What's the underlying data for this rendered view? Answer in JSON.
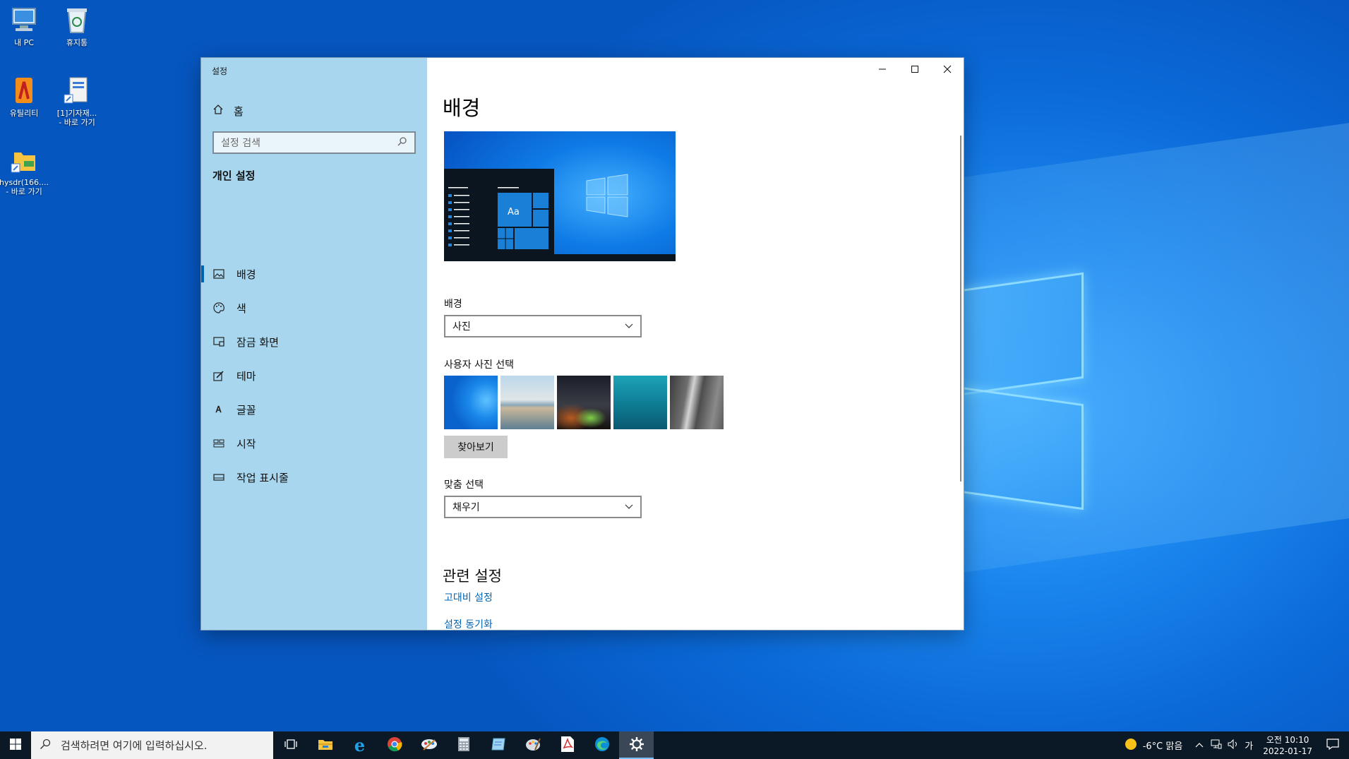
{
  "desktop": {
    "icons": [
      {
        "label": "내 PC",
        "icon": "computer-icon"
      },
      {
        "label": "휴지통",
        "icon": "recycle-bin-icon"
      },
      {
        "label": "유틸리티",
        "icon": "utility-app-icon"
      },
      {
        "label": "[1]기자재...",
        "label2": "- 바로 가기",
        "icon": "shortcut-file-icon"
      },
      {
        "label": "hysdr(166....",
        "label2": "- 바로 가기",
        "icon": "shortcut-folder-icon"
      }
    ]
  },
  "window": {
    "title": "설정",
    "controls": {
      "minimize": "minimize-icon",
      "maximize": "maximize-icon",
      "close": "close-icon"
    }
  },
  "sidebar": {
    "home": "홈",
    "search_placeholder": "설정 검색",
    "group": "개인 설정",
    "items": [
      {
        "label": "배경",
        "icon": "picture-icon",
        "active": true
      },
      {
        "label": "색",
        "icon": "palette-icon",
        "active": false
      },
      {
        "label": "잠금 화면",
        "icon": "lock-screen-icon",
        "active": false
      },
      {
        "label": "테마",
        "icon": "theme-brush-icon",
        "active": false
      },
      {
        "label": "글꼴",
        "icon": "font-icon",
        "active": false
      },
      {
        "label": "시작",
        "icon": "start-tiles-icon",
        "active": false
      },
      {
        "label": "작업 표시줄",
        "icon": "taskbar-icon",
        "active": false
      }
    ]
  },
  "content": {
    "title": "배경",
    "preview_tile": "Aa",
    "background_label": "배경",
    "background_value": "사진",
    "choose_picture_label": "사용자 사진 선택",
    "browse_button": "찾아보기",
    "fit_label": "맞춤 선택",
    "fit_value": "채우기",
    "related_title": "관련 설정",
    "links": [
      "고대비 설정",
      "설정 동기화"
    ]
  },
  "taskbar": {
    "search_placeholder": "검색하려면 여기에 입력하십시오.",
    "apps": [
      "task-view-icon",
      "file-explorer-icon",
      "internet-explorer-icon",
      "chrome-icon",
      "paint-app-icon",
      "calculator-icon",
      "notepad-app-icon",
      "paint-palette-icon",
      "pdf-icon",
      "edge-icon",
      "settings-gear-icon"
    ],
    "weather": "-6°C 맑음",
    "ime": "가",
    "time": "오전 10:10",
    "date": "2022-01-17"
  },
  "colors": {
    "accent": "#0063b1",
    "sidebar_bg": "#a7d6ee",
    "taskbar_bg": "#0b1826"
  }
}
